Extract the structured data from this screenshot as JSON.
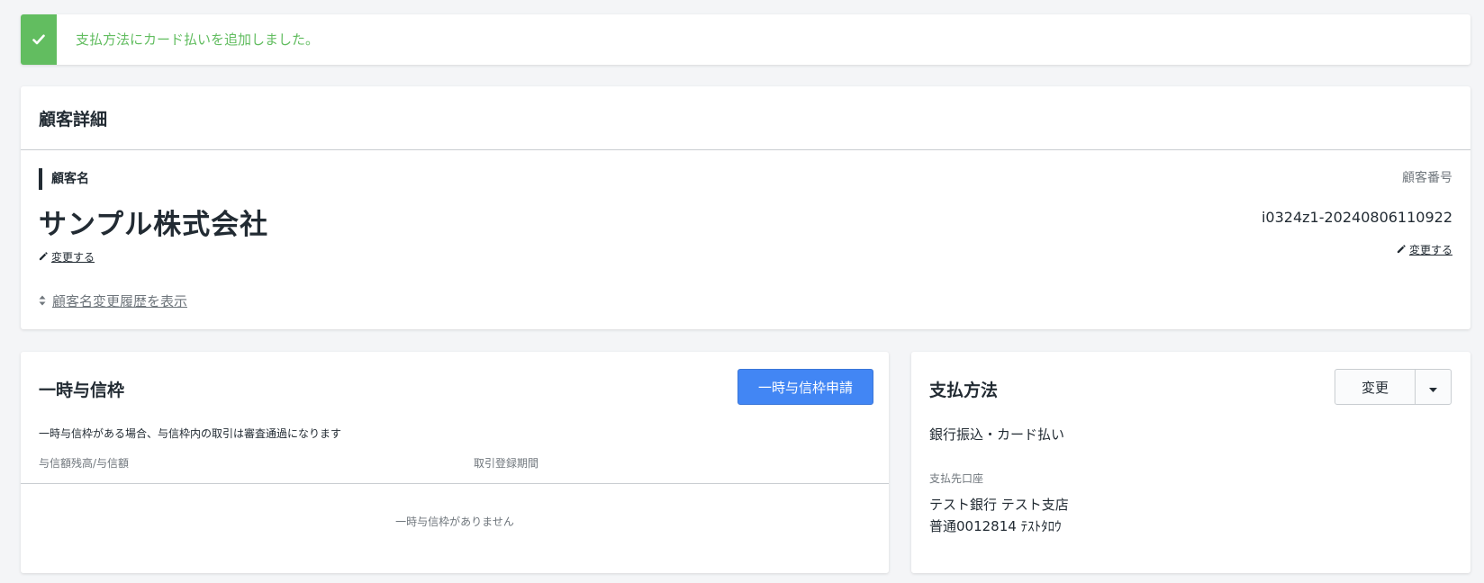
{
  "alert": {
    "message": "支払方法にカード払いを追加しました。",
    "icon": "check-icon",
    "color": "#62bd60"
  },
  "customer": {
    "title": "顧客詳細",
    "name_label": "顧客名",
    "name": "サンプル株式会社",
    "edit_label": "変更する",
    "history_label": "顧客名変更履歴を表示",
    "number_label": "顧客番号",
    "number": "i0324z1-20240806110922",
    "number_edit_label": "変更する"
  },
  "credit": {
    "title": "一時与信枠",
    "apply_button": "一時与信枠申請",
    "description": "一時与信枠がある場合、与信枠内の取引は審査通過になります",
    "columns": [
      "与信額残高/与信額",
      "取引登録期間"
    ],
    "empty_message": "一時与信枠がありません",
    "accent": "#4286f4"
  },
  "payment": {
    "title": "支払方法",
    "change_button": "変更",
    "method": "銀行振込・カード払い",
    "account_label": "支払先口座",
    "bank": "テスト銀行 テスト支店",
    "account": "普通0012814 ﾃｽﾄﾀﾛｳ"
  }
}
